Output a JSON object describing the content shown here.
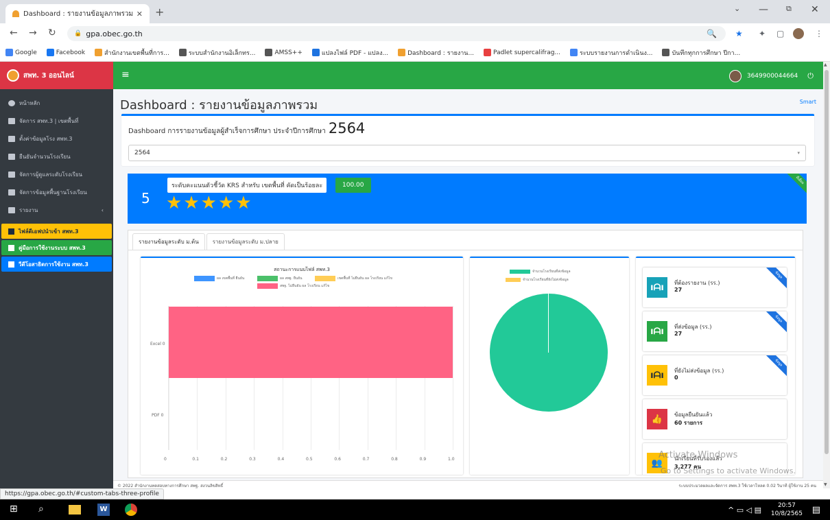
{
  "browser": {
    "tab_title": "Dashboard : รายงานข้อมูลภาพรวม",
    "tab_close": "✕",
    "new_tab": "+",
    "url": "gpa.obec.go.th",
    "bookmarks": [
      {
        "label": "Google",
        "color": "#4285f4"
      },
      {
        "label": "Facebook",
        "color": "#1877f2"
      },
      {
        "label": "สำนักงานเขตพื้นที่การ...",
        "color": "#f0a030"
      },
      {
        "label": "ระบบสำนักงานอิเล็กทร...",
        "color": "#555555"
      },
      {
        "label": "AMSS++",
        "color": "#555555"
      },
      {
        "label": "แปลงไฟล์ PDF - แปลง...",
        "color": "#1e73e0"
      },
      {
        "label": "Dashboard : รายงาน...",
        "color": "#f0a030"
      },
      {
        "label": "Padlet supercalifrag...",
        "color": "#e84040"
      },
      {
        "label": "ระบบรายงานการดำเนินง...",
        "color": "#4285f4"
      },
      {
        "label": "บันทึกทุกการศึกษา ปีกา...",
        "color": "#555555"
      }
    ]
  },
  "sidebar": {
    "brand": "สพท. 3 ออนไลน์",
    "items": [
      {
        "label": "หน้าหลัก"
      },
      {
        "label": "จัดการ สพท.3 | เขตพื้นที่"
      },
      {
        "label": "ตั้งค่าข้อมูลโรง สพท.3"
      },
      {
        "label": "ยืนยันจำนวนโรงเรียน"
      },
      {
        "label": "จัดการผู้ดูแลระดับโรงเรียน"
      },
      {
        "label": "จัดการข้อมูลพื้นฐานโรงเรียน"
      },
      {
        "label": "รายงาน",
        "caret": "‹"
      }
    ],
    "highlights": [
      {
        "label": "ไฟล์ดีเอฟปนำเข้า สพท.3"
      },
      {
        "label": "คู่มือการใช้งานระบบ สพท.3"
      },
      {
        "label": "วีดีโอสาธิตการใช้งาน สพท.3"
      }
    ]
  },
  "topnav": {
    "menu_icon": "≡",
    "user_id": "3649900044664",
    "power_icon": "⏻"
  },
  "page": {
    "title": "Dashboard : รายงานข้อมูลภาพรวม",
    "small_link": "Smart",
    "subtitle_prefix": "Dashboard การรายงานข้อมูลผู้สำเร็จการศึกษา ประจำปีการศึกษา",
    "subtitle_year": "2564",
    "select_value": "2564"
  },
  "banner": {
    "number": "5",
    "tip": "ระดับคะแนนตัวชี้วัด KRS สำหรับ เขตพื้นที่ คัดเป็นร้อยละ",
    "score": "100.00",
    "stars": [
      "★",
      "★",
      "★",
      "★",
      "★"
    ],
    "ribbon": "ดีเยี่ยม"
  },
  "tabs": [
    {
      "label": "รายงานข้อมูลระดับ ม.ต้น"
    },
    {
      "label": "รายงานข้อมูลระดับ ม.ปลาย"
    }
  ],
  "chart_data": [
    {
      "type": "bar",
      "orientation": "horizontal",
      "title": "สถานะการแนบไฟล์ สพท.3",
      "categories": [
        "Excel",
        "PDF"
      ],
      "category_labels": [
        "Excel 0",
        "PDF 0"
      ],
      "xlim": [
        0,
        1.0
      ],
      "x_ticks": [
        "0",
        "0.1",
        "0.2",
        "0.3",
        "0.4",
        "0.5",
        "0.6",
        "0.7",
        "0.8",
        "0.9",
        "1.0"
      ],
      "legend_position": "top",
      "grid": true,
      "series": [
        {
          "name": "ผล เขตพื้นที่ ยืนยัน",
          "color": "#3e95ff",
          "values": [
            0,
            0
          ]
        },
        {
          "name": "ผล สพฐ. ยืนยัน",
          "color": "#4bc06a",
          "values": [
            0,
            0
          ]
        },
        {
          "name": "เขตพื้นที่ ไม่ยืนยัน ผล โรงเรียน แก้ไข",
          "color": "#ffcd56",
          "values": [
            0,
            0
          ]
        },
        {
          "name": "สพฐ. ไม่ยืนยัน ผล โรงเรียน แก้ไข",
          "color": "#ff6384",
          "values": [
            1,
            0
          ]
        }
      ]
    },
    {
      "type": "pie",
      "legend_position": "top",
      "labels": [
        "จำนวนโรงเรียนที่ส่งข้อมูล",
        "จำนวนโรงเรียนที่ยังไม่ส่งข้อมูล"
      ],
      "values": [
        27,
        0
      ],
      "colors": [
        "#22c998",
        "#ffcd56"
      ]
    }
  ],
  "info_cards": [
    {
      "label": "ที่ต้องรายงาน (รร.)",
      "value": "27",
      "color": "#17a2b8",
      "icon": "school-icon",
      "glyph": "ıᗩı",
      "ribbon": "ข้อมูล"
    },
    {
      "label": "ที่ส่งข้อมูล (รร.)",
      "value": "27",
      "color": "#28a745",
      "icon": "school-icon",
      "glyph": "ıᗩı",
      "ribbon": "ข้อมูล"
    },
    {
      "label": "ที่ยังไม่ส่งข้อมูล (รร.)",
      "value": "0",
      "color": "#ffc107",
      "icon": "school-icon",
      "glyph": "ıᗩı",
      "ribbon": "ข้อมูล"
    },
    {
      "label": "ข้อมูลยืนยันแล้ว",
      "value": "60 รายการ",
      "color": "#dc3545",
      "icon": "thumbs-up-icon",
      "glyph": "👍"
    },
    {
      "label": "นักเรียนที่รับรองแล้ว",
      "value": "3,277 คน",
      "color": "#ffc107",
      "icon": "users-icon",
      "glyph": "👥"
    }
  ],
  "watermark": {
    "line1": "Activate Windows",
    "line2": "Go to Settings to activate Windows."
  },
  "footer": {
    "left": "© 2022 สำนักงานทดสอบทางการศึกษา สพฐ. สงวนลิขสิทธิ์",
    "right": "ระบบประมวลผลและจัดการ สพท.3 ใช้เวลาโหลด 0.02 วินาที ผู้ใช้งาน 25 คน"
  },
  "statusbar": {
    "url": "https://gpa.obec.go.th/#custom-tabs-three-profile"
  },
  "taskbar": {
    "time": "20:57",
    "date": "10/8/2565"
  }
}
